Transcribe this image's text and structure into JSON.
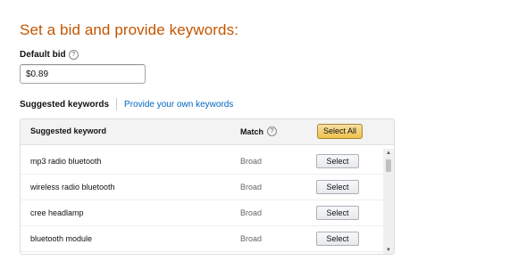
{
  "page": {
    "title": "Set a bid and provide keywords:"
  },
  "bid": {
    "label": "Default bid",
    "help_icon": "question-circle-icon",
    "value": "$0.89"
  },
  "keyword_tabs": {
    "active": "Suggested keywords",
    "link": "Provide your own keywords"
  },
  "table": {
    "headers": {
      "keyword": "Suggested keyword",
      "match": "Match",
      "select_all": "Select All"
    },
    "rows": [
      {
        "keyword": "mp3 radio bluetooth",
        "match": "Broad",
        "action": "Select"
      },
      {
        "keyword": "wireless radio bluetooth",
        "match": "Broad",
        "action": "Select"
      },
      {
        "keyword": "cree headlamp",
        "match": "Broad",
        "action": "Select"
      },
      {
        "keyword": "bluetooth module",
        "match": "Broad",
        "action": "Select"
      }
    ]
  },
  "colors": {
    "title": "#c45500",
    "link": "#0066c0",
    "select_all_button": "#f0c14b"
  }
}
